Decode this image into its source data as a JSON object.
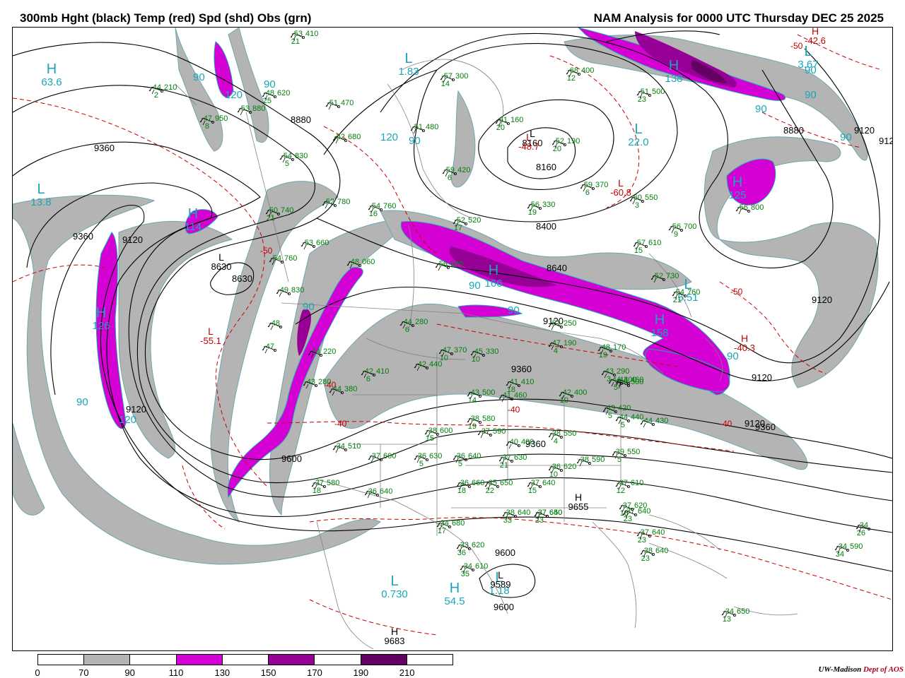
{
  "header": {
    "left_title": "300mb Hght (black) Temp (red) Spd (shd) Obs (grn)",
    "right_title": "NAM Analysis for 0000 UTC Thursday  DEC 25 2025"
  },
  "colors": {
    "speed_70_90": "#b4b4b4",
    "speed_110_130": "#d400d4",
    "speed_150_170": "#960096",
    "speed_190_210": "#640064",
    "height": "#000000",
    "temperature": "#c80000",
    "obs": "#00800a",
    "centers": "#1aa6b8",
    "borders": "#808080"
  },
  "legend": {
    "ticks": [
      "0",
      "70",
      "90",
      "110",
      "130",
      "150",
      "170",
      "190",
      "210"
    ],
    "segment_colors": [
      "#ffffff",
      "#b4b4b4",
      "#ffffff",
      "#d400d4",
      "#ffffff",
      "#960096",
      "#ffffff",
      "#640064",
      "#ffffff"
    ]
  },
  "credit": {
    "org": "UW-Madison",
    "dept": "Dept of AOS"
  },
  "centers": [
    {
      "letter": "H",
      "value": "63.6",
      "color": "cyan"
    },
    {
      "letter": "L",
      "value": "13.8",
      "color": "cyan"
    },
    {
      "letter": "H",
      "value": "126",
      "color": "cyan"
    },
    {
      "letter": "H",
      "value": "114",
      "color": "cyan"
    },
    {
      "letter": "L",
      "value": "1.83",
      "color": "cyan"
    },
    {
      "letter": "L",
      "value": "22.0",
      "color": "cyan"
    },
    {
      "letter": "L",
      "value": "3.67",
      "color": "cyan"
    },
    {
      "letter": "H",
      "value": "125",
      "color": "cyan"
    },
    {
      "letter": "H",
      "value": "138",
      "color": "cyan"
    },
    {
      "letter": "L",
      "value": "5.51",
      "color": "cyan"
    },
    {
      "letter": "H",
      "value": "158",
      "color": "cyan"
    },
    {
      "letter": "L",
      "value": "0.730",
      "color": "cyan"
    },
    {
      "letter": "H",
      "value": "54.5",
      "color": "cyan"
    },
    {
      "letter": "L",
      "value": "1.18",
      "color": "cyan"
    },
    {
      "letter": "H",
      "value": "166",
      "color": "cyan"
    },
    {
      "letter": "L",
      "value": "8160",
      "color": "black"
    },
    {
      "letter": "L",
      "value": "8630",
      "color": "black"
    },
    {
      "letter": "H",
      "value": "9655",
      "color": "black"
    },
    {
      "letter": "L",
      "value": "9589",
      "color": "black"
    },
    {
      "letter": "H",
      "value": "9683",
      "color": "black"
    },
    {
      "letter": "L",
      "value": "-55.1",
      "color": "red"
    },
    {
      "letter": "L",
      "value": "-60.8",
      "color": "red"
    },
    {
      "letter": "H",
      "value": "-42.6",
      "color": "red"
    },
    {
      "letter": "H",
      "value": "-40.3",
      "color": "red"
    },
    {
      "letter": "L",
      "value": "-48.7",
      "color": "red"
    }
  ],
  "height_labels": [
    "9360",
    "9360",
    "9120",
    "8880",
    "8630",
    "8640",
    "8400",
    "8160",
    "8880",
    "9120",
    "9120",
    "9120",
    "9120",
    "9360",
    "9360",
    "9600",
    "9600",
    "9600",
    "9120",
    "9360",
    "9120",
    "9120"
  ],
  "temp_labels": [
    "-50",
    "-40",
    "-40",
    "-40",
    "-50",
    "-40",
    "-50"
  ],
  "speed_labels": [
    "90",
    "90",
    "120",
    "90",
    "90",
    "90",
    "120",
    "90",
    "90",
    "90",
    "90",
    "90",
    "90",
    "90",
    "120"
  ],
  "obs": [
    {
      "t": "-53",
      "h": "410",
      "s": "21"
    },
    {
      "t": "-44",
      "h": "210",
      "s": "2"
    },
    {
      "t": "-48",
      "h": "620",
      "s": "25"
    },
    {
      "t": "-53",
      "h": "880",
      "s": ""
    },
    {
      "t": "-47",
      "h": "950",
      "s": "8"
    },
    {
      "t": "-51",
      "h": "470",
      "s": ""
    },
    {
      "t": "-57",
      "h": "300",
      "s": "14"
    },
    {
      "t": "-68",
      "h": "400",
      "s": "12"
    },
    {
      "t": "-51",
      "h": "500",
      "s": "23"
    },
    {
      "t": "-61",
      "h": "160",
      "s": "20"
    },
    {
      "t": "-52",
      "h": "190",
      "s": "20"
    },
    {
      "t": "-52",
      "h": "680",
      "s": ""
    },
    {
      "t": "-51",
      "h": "480",
      "s": ""
    },
    {
      "t": "-54",
      "h": "830",
      "s": "5"
    },
    {
      "t": "-59",
      "h": "420",
      "s": "6"
    },
    {
      "t": "-59",
      "h": "370",
      "s": "6"
    },
    {
      "t": "-60",
      "h": "550",
      "s": "3"
    },
    {
      "t": "-56",
      "h": "800",
      "s": ""
    },
    {
      "t": "-50",
      "h": "740",
      "s": "21"
    },
    {
      "t": "-52",
      "h": "780",
      "s": ""
    },
    {
      "t": "-54",
      "h": "760",
      "s": "16"
    },
    {
      "t": "-56",
      "h": "330",
      "s": "19"
    },
    {
      "t": "-52",
      "h": "520",
      "s": "17"
    },
    {
      "t": "-56",
      "h": "700",
      "s": "9"
    },
    {
      "t": "-57",
      "h": "610",
      "s": "15"
    },
    {
      "t": "-53",
      "h": "660",
      "s": ""
    },
    {
      "t": "-54",
      "h": "760",
      "s": ""
    },
    {
      "t": "-49",
      "h": "830",
      "s": ""
    },
    {
      "t": "-48",
      "h": "060",
      "s": ""
    },
    {
      "t": "-56",
      "h": "990",
      "s": ""
    },
    {
      "t": "-52",
      "h": "730",
      "s": ""
    },
    {
      "t": "-54",
      "h": "760",
      "s": "21"
    },
    {
      "t": "-48",
      "h": "",
      "s": ""
    },
    {
      "t": "-47",
      "h": "",
      "s": ""
    },
    {
      "t": "-44",
      "h": "280",
      "s": "6"
    },
    {
      "t": "-44",
      "h": "220",
      "s": ""
    },
    {
      "t": "-42",
      "h": "410",
      "s": "6"
    },
    {
      "t": "-42",
      "h": "440",
      "s": ""
    },
    {
      "t": "-44",
      "h": "380",
      "s": ""
    },
    {
      "t": "-43",
      "h": "280",
      "s": ""
    },
    {
      "t": "-47",
      "h": "370",
      "s": "10"
    },
    {
      "t": "-45",
      "h": "330",
      "s": "10"
    },
    {
      "t": "-47",
      "h": "190",
      "s": "4"
    },
    {
      "t": "-48",
      "h": "170",
      "s": "19"
    },
    {
      "t": "-51",
      "h": "250",
      "s": ""
    },
    {
      "t": "-43",
      "h": "500",
      "s": "14"
    },
    {
      "t": "-41",
      "h": "410",
      "s": "18"
    },
    {
      "t": "-41",
      "h": "460",
      "s": ""
    },
    {
      "t": "-42",
      "h": "400",
      "s": "10"
    },
    {
      "t": "-40",
      "h": "500",
      "s": ""
    },
    {
      "t": "-44",
      "h": "460",
      "s": ""
    },
    {
      "t": "-43",
      "h": "290",
      "s": "3"
    },
    {
      "t": "-44",
      "h": "300",
      "s": "5"
    },
    {
      "t": "-43",
      "h": "420",
      "s": "5"
    },
    {
      "t": "-44",
      "h": "440",
      "s": "5"
    },
    {
      "t": "-44",
      "h": "430",
      "s": ""
    },
    {
      "t": "-38",
      "h": "600",
      "s": "15"
    },
    {
      "t": "-38",
      "h": "580",
      "s": "19"
    },
    {
      "t": "-37",
      "h": "590",
      "s": ""
    },
    {
      "t": "-38",
      "h": "550",
      "s": "4"
    },
    {
      "t": "-40",
      "h": "400",
      "s": ""
    },
    {
      "t": "-36",
      "h": "630",
      "s": "5"
    },
    {
      "t": "-36",
      "h": "640",
      "s": "5"
    },
    {
      "t": "-37",
      "h": "630",
      "s": "21"
    },
    {
      "t": "-36",
      "h": "620",
      "s": "10"
    },
    {
      "t": "-38",
      "h": "590",
      "s": ""
    },
    {
      "t": "-39",
      "h": "550",
      "s": "5"
    },
    {
      "t": "-37",
      "h": "600",
      "s": ""
    },
    {
      "t": "-34",
      "h": "510",
      "s": ""
    },
    {
      "t": "-37",
      "h": "580",
      "s": "18"
    },
    {
      "t": "-36",
      "h": "640",
      "s": ""
    },
    {
      "t": "-36",
      "h": "660",
      "s": "18"
    },
    {
      "t": "-35",
      "h": "650",
      "s": "22"
    },
    {
      "t": "-37",
      "h": "640",
      "s": "15"
    },
    {
      "t": "-37",
      "h": "610",
      "s": "12"
    },
    {
      "t": "-37",
      "h": "620",
      "s": "18"
    },
    {
      "t": "-38",
      "h": "640",
      "s": "33"
    },
    {
      "t": "-37",
      "h": "640",
      "s": "23"
    },
    {
      "t": "-37",
      "h": "650",
      "s": ""
    },
    {
      "t": "-37",
      "h": "640",
      "s": "23"
    },
    {
      "t": "-37",
      "h": "640",
      "s": "23"
    },
    {
      "t": "-38",
      "h": "640",
      "s": "23"
    },
    {
      "t": "-34",
      "h": "680",
      "s": "17"
    },
    {
      "t": "-33",
      "h": "620",
      "s": "36"
    },
    {
      "t": "-34",
      "h": "610",
      "s": "35"
    },
    {
      "t": "-34",
      "h": "670",
      "s": ""
    },
    {
      "t": "-34",
      "h": "590",
      "s": "34"
    },
    {
      "t": "-34",
      "h": "",
      "s": "26"
    },
    {
      "t": "-34",
      "h": "650",
      "s": "13"
    }
  ]
}
